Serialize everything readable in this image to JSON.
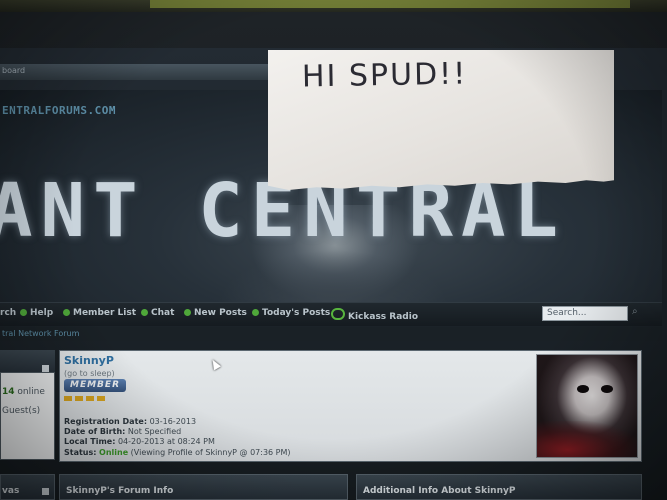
{
  "note": {
    "text": "HI SPUD!!"
  },
  "browser": {
    "address_fragment": "board"
  },
  "banner": {
    "site_url": "ENTRALFORUMS.COM",
    "title": "ANT CENTRAL"
  },
  "nav": {
    "items": [
      {
        "label": "rch"
      },
      {
        "label": "Help"
      },
      {
        "label": "Member List"
      },
      {
        "label": "Chat"
      },
      {
        "label": "New Posts"
      },
      {
        "label": "Today's Posts"
      },
      {
        "label": "Kickass Radio"
      }
    ],
    "search_placeholder": "Search..."
  },
  "subbar": {
    "text": "tral Network Forum"
  },
  "sidebar": {
    "online_count": "14",
    "online_label": "online",
    "guests_label": "Guest(s)",
    "bottom_label": "vas"
  },
  "profile": {
    "name": "SkinnyP",
    "status_text": "(go to sleep)",
    "rank": "MEMBER",
    "fields": {
      "registration_label": "Registration Date:",
      "registration_value": "03-16-2013",
      "dob_label": "Date of Birth:",
      "dob_value": "Not Specified",
      "local_time_label": "Local Time:",
      "local_time_value": "04-20-2013 at 08:24 PM",
      "status_label": "Status:",
      "status_value": "Online",
      "status_detail": "(Viewing Profile of SkinnyP @ 07:36 PM)"
    }
  },
  "bottom_panels": {
    "forum_info": "SkinnyP's Forum Info",
    "additional_info": "Additional Info About SkinnyP"
  },
  "colors": {
    "accent_blue": "#2f6fa0",
    "online_green": "#3c9a2a",
    "nav_icon_green": "#4fa83a"
  }
}
